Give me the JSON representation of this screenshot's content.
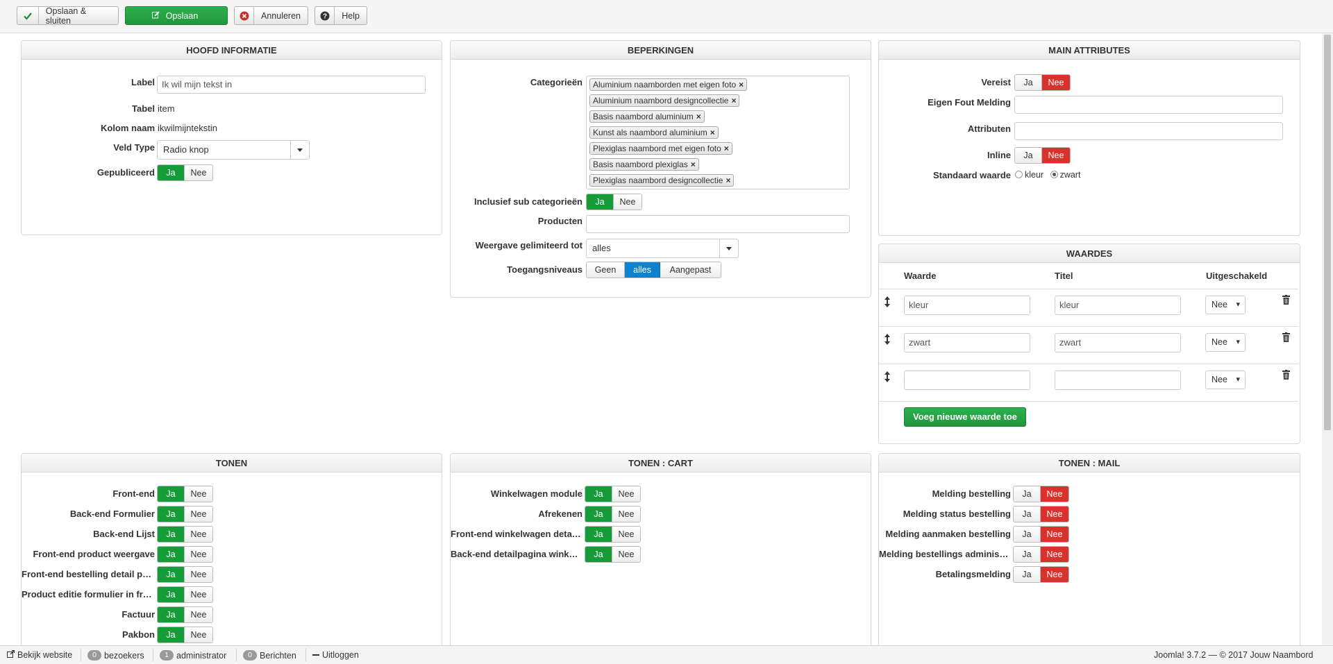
{
  "toolbar": {
    "save_close": "Opslaan & sluiten",
    "save": "Opslaan",
    "cancel": "Annuleren",
    "help": "Help"
  },
  "main_info": {
    "title": "HOOFD INFORMATIE",
    "label_label": "Label",
    "label_value": "Ik wil mijn tekst in",
    "table_label": "Tabel",
    "table_value": "item",
    "column_label": "Kolom naam",
    "column_value": "ikwilmijntekstin",
    "field_type_label": "Veld Type",
    "field_type_value": "Radio knop",
    "published_label": "Gepubliceerd",
    "published": "Ja"
  },
  "restrictions": {
    "title": "BEPERKINGEN",
    "categories_label": "Categorieën",
    "categories": [
      "Aluminium naamborden met eigen foto",
      "Aluminium naambord designcollectie",
      "Basis naambord aluminium",
      "Kunst als naambord aluminium",
      "Plexiglas naambord met eigen foto",
      "Basis naambord plexiglas",
      "Plexiglas naambord designcollectie"
    ],
    "include_sub_label": "Inclusief sub categorieën",
    "include_sub": "Ja",
    "products_label": "Producten",
    "display_limited_label": "Weergave gelimiteerd tot",
    "display_limited_value": "alles",
    "access_label": "Toegangsniveaus",
    "access_options": [
      "Geen",
      "alles",
      "Aangepast"
    ],
    "access_selected": "alles"
  },
  "main_attributes": {
    "title": "MAIN ATTRIBUTES",
    "required_label": "Vereist",
    "required": "Nee",
    "error_label": "Eigen Fout Melding",
    "attributes_label": "Attributen",
    "inline_label": "Inline",
    "inline": "Nee",
    "default_label": "Standaard waarde",
    "default_options": [
      "kleur",
      "zwart"
    ],
    "default_selected": "zwart"
  },
  "values": {
    "title": "WAARDES",
    "col_value": "Waarde",
    "col_title": "Titel",
    "col_disabled": "Uitgeschakeld",
    "rows": [
      {
        "value": "kleur",
        "title": "kleur",
        "disabled": "Nee"
      },
      {
        "value": "zwart",
        "title": "zwart",
        "disabled": "Nee"
      },
      {
        "value": "",
        "title": "",
        "disabled": "Nee"
      }
    ],
    "add_button": "Voeg nieuwe waarde toe"
  },
  "show": {
    "title": "TONEN",
    "items": [
      {
        "label": "Front-end",
        "value": "Ja"
      },
      {
        "label": "Back-end Formulier",
        "value": "Ja"
      },
      {
        "label": "Back-end Lijst",
        "value": "Ja"
      },
      {
        "label": "Front-end product weergave",
        "value": "Ja"
      },
      {
        "label": "Front-end bestelling detail pagina",
        "value": "Ja"
      },
      {
        "label": "Product editie formulier in front-end",
        "value": "Ja"
      },
      {
        "label": "Factuur",
        "value": "Ja"
      },
      {
        "label": "Pakbon",
        "value": "Ja"
      }
    ]
  },
  "show_cart": {
    "title": "TONEN : CART",
    "items": [
      {
        "label": "Winkelwagen module",
        "value": "Ja"
      },
      {
        "label": "Afrekenen",
        "value": "Ja"
      },
      {
        "label": "Front-end winkelwagen detail pagina",
        "value": "Ja"
      },
      {
        "label": "Back-end detailpagina winkelwagen",
        "value": "Ja"
      }
    ]
  },
  "show_mail": {
    "title": "TONEN : MAIL",
    "items": [
      {
        "label": "Melding bestelling",
        "value": "Nee"
      },
      {
        "label": "Melding status bestelling",
        "value": "Nee"
      },
      {
        "label": "Melding aanmaken bestelling",
        "value": "Nee"
      },
      {
        "label": "Melding bestellings administrator",
        "value": "Nee"
      },
      {
        "label": "Betalingsmelding",
        "value": "Nee"
      }
    ]
  },
  "toggle": {
    "yes": "Ja",
    "no": "Nee"
  },
  "statusbar": {
    "view_site": "Bekijk website",
    "visitors_count": "0",
    "visitors": "bezoekers",
    "admin_count": "1",
    "admin": "administrator",
    "messages_count": "0",
    "messages": "Berichten",
    "logout": "Uitloggen",
    "version": "Joomla! 3.7.2 — © 2017 Jouw Naambord"
  },
  "colors": {
    "green": "#159b37",
    "red": "#d9322d",
    "blue": "#0c82d1"
  }
}
